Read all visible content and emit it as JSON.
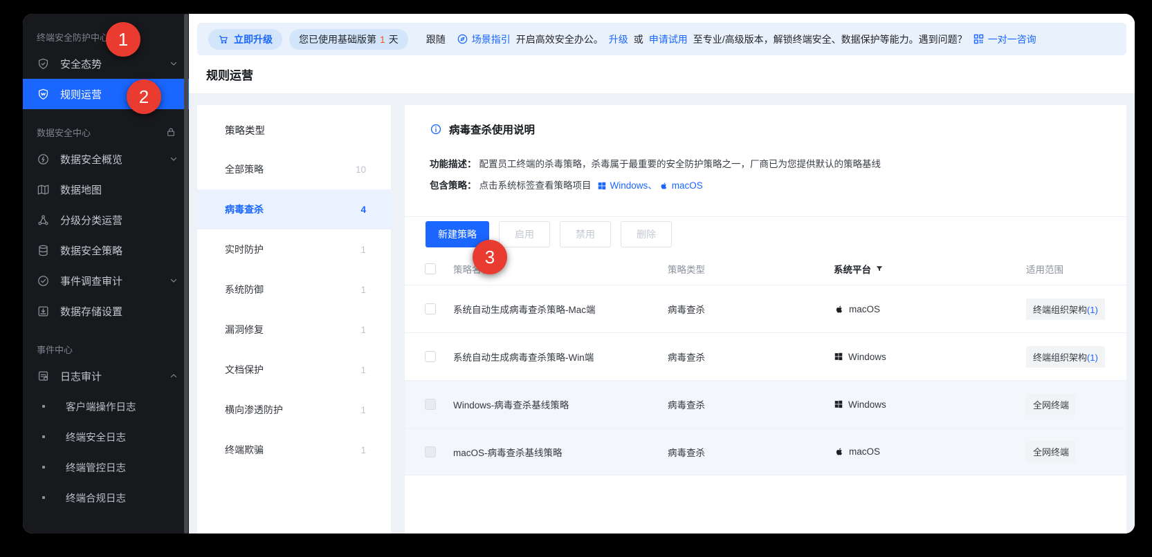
{
  "colors": {
    "accent": "#1a66ff",
    "badge_red": "#e93b30",
    "banner_bg": "#e8f1fc",
    "sidebar_bg": "#18191d",
    "trial_day_orange": "#f5571e"
  },
  "sidebar": {
    "header1": "终端安全防护中心",
    "nav1": [
      {
        "label": "安全态势"
      },
      {
        "label": "规则运营"
      }
    ],
    "header2": "数据安全中心",
    "nav2": [
      {
        "label": "数据安全概览"
      },
      {
        "label": "数据地图"
      },
      {
        "label": "分级分类运营"
      },
      {
        "label": "数据安全策略"
      },
      {
        "label": "事件调查审计"
      },
      {
        "label": "数据存储设置"
      }
    ],
    "header3": "事件中心",
    "nav3": [
      {
        "label": "日志审计"
      },
      {
        "label": "客户端操作日志"
      },
      {
        "label": "终端安全日志"
      },
      {
        "label": "终端管控日志"
      },
      {
        "label": "终端合规日志"
      }
    ]
  },
  "banner": {
    "upgrade_now": "立即升级",
    "trial_pre": "您已使用基础版第",
    "trial_day": "1",
    "trial_post": "天",
    "follow": "跟随",
    "scene_guide": "场景指引",
    "office": "开启高效安全办公。",
    "upgrade_link": "升级",
    "or": "或",
    "apply_trial": "申请试用",
    "desc": "至专业/高级版本，解锁终端安全、数据保护等能力。遇到问题？",
    "consult": "一对一咨询"
  },
  "page": {
    "title": "规则运营"
  },
  "left_panel": {
    "header": "策略类型",
    "items": [
      {
        "label": "全部策略",
        "count": "10"
      },
      {
        "label": "病毒查杀",
        "count": "4"
      },
      {
        "label": "实时防护",
        "count": "1"
      },
      {
        "label": "系统防御",
        "count": "1"
      },
      {
        "label": "漏洞修复",
        "count": "1"
      },
      {
        "label": "文档保护",
        "count": "1"
      },
      {
        "label": "横向渗透防护",
        "count": "1"
      },
      {
        "label": "终端欺骗",
        "count": "1"
      }
    ]
  },
  "main": {
    "info": {
      "title": "病毒查杀使用说明",
      "desc_label": "功能描述：",
      "desc_text": "配置员工终端的杀毒策略，杀毒属于最重要的安全防护策略之一，厂商已为您提供默认的策略基线",
      "include_label": "包含策略：",
      "include_text": "点击系统标签查看策略项目",
      "win": "Windows、",
      "mac": "macOS"
    },
    "toolbar": {
      "create": "新建策略",
      "enable": "启用",
      "disable": "禁用",
      "delete": "删除"
    },
    "table": {
      "headers": {
        "name": "策略名称",
        "type": "策略类型",
        "platform": "系统平台",
        "scope": "适用范围"
      },
      "rows": [
        {
          "name": "系统自动生成病毒查杀策略-Mac端",
          "type": "病毒查杀",
          "platform": "macOS",
          "scope": "终端组织架构",
          "scope_suffix": "(1)"
        },
        {
          "name": "系统自动生成病毒查杀策略-Win端",
          "type": "病毒查杀",
          "platform": "Windows",
          "scope": "终端组织架构",
          "scope_suffix": "(1)"
        },
        {
          "name": "Windows-病毒查杀基线策略",
          "type": "病毒查杀",
          "platform": "Windows",
          "scope": "全网终端",
          "scope_suffix": ""
        },
        {
          "name": "macOS-病毒查杀基线策略",
          "type": "病毒查杀",
          "platform": "macOS",
          "scope": "全网终端",
          "scope_suffix": ""
        }
      ]
    }
  },
  "annotations": {
    "badge1": "1",
    "badge2": "2",
    "badge3": "3"
  }
}
